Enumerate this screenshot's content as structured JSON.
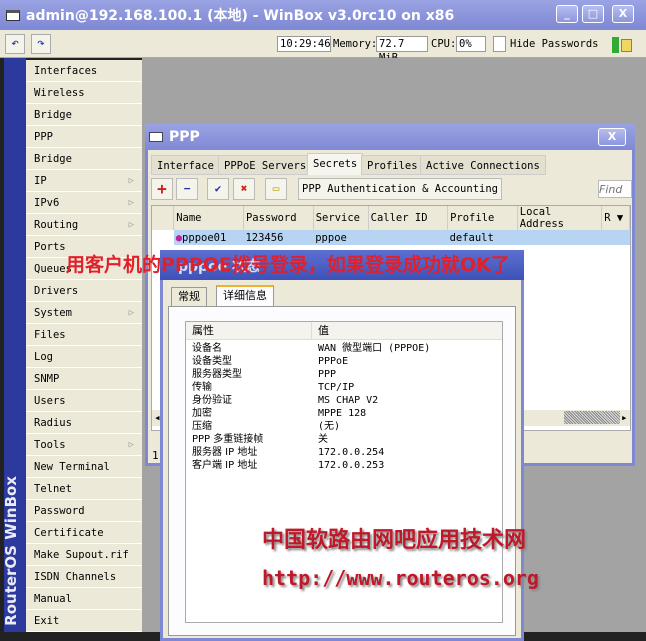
{
  "window": {
    "title": "admin@192.168.100.1 (本地) - WinBox v3.0rc10 on x86",
    "minimize": "_",
    "maximize": "□",
    "close": "X"
  },
  "toolbar": {
    "undo": "↶",
    "redo": "↷",
    "time": "10:29:46",
    "memory_label": "Memory:",
    "memory": "72.7 MiB",
    "cpu_label": "CPU:",
    "cpu": "0%",
    "hide_passwords": "Hide Passwords",
    "hide_passwords_checked": false
  },
  "sidebar": {
    "brand": "RouterOS WinBox",
    "items": [
      {
        "label": "Interfaces"
      },
      {
        "label": "Wireless"
      },
      {
        "label": "Bridge"
      },
      {
        "label": "PPP"
      },
      {
        "label": "Bridge"
      },
      {
        "label": "IP",
        "submenu": true
      },
      {
        "label": "IPv6",
        "submenu": true
      },
      {
        "label": "Routing",
        "submenu": true
      },
      {
        "label": "Ports"
      },
      {
        "label": "Queues"
      },
      {
        "label": "Drivers"
      },
      {
        "label": "System",
        "submenu": true
      },
      {
        "label": "Files"
      },
      {
        "label": "Log"
      },
      {
        "label": "SNMP"
      },
      {
        "label": "Users"
      },
      {
        "label": "Radius"
      },
      {
        "label": "Tools",
        "submenu": true
      },
      {
        "label": "New Terminal"
      },
      {
        "label": "Telnet"
      },
      {
        "label": "Password"
      },
      {
        "label": "Certificate"
      },
      {
        "label": "Make Supout.rif"
      },
      {
        "label": "ISDN Channels"
      },
      {
        "label": "Manual"
      },
      {
        "label": "Exit"
      }
    ]
  },
  "ppp": {
    "title": "PPP",
    "close": "X",
    "tabs": [
      "Interface",
      "PPPoE Servers",
      "Secrets",
      "Profiles",
      "Active Connections"
    ],
    "active_tab": "Secrets",
    "auth_button": "PPP Authentication & Accounting",
    "find_placeholder": "Find",
    "columns": [
      "Name",
      "Password",
      "Service",
      "Caller ID",
      "Profile",
      "Local Address",
      "R"
    ],
    "rows": [
      [
        "pppoe01",
        "123456",
        "pppoe",
        "",
        "default",
        ""
      ]
    ],
    "status": "1"
  },
  "dialog": {
    "title": "pppoe 状态",
    "tabs": [
      "常规",
      "详细信息"
    ],
    "active_tab": "详细信息",
    "headers": [
      "属性",
      "值"
    ],
    "rows": [
      [
        "设备名",
        "WAN 微型端口 (PPPOE)"
      ],
      [
        "设备类型",
        "PPPoE"
      ],
      [
        "服务器类型",
        "PPP"
      ],
      [
        "传输",
        "TCP/IP"
      ],
      [
        "身份验证",
        "MS CHAP V2"
      ],
      [
        "加密",
        "MPPE 128"
      ],
      [
        "压缩",
        "(无)"
      ],
      [
        "PPP 多重链接帧",
        "关"
      ],
      [
        "服务器 IP 地址",
        "172.0.0.254"
      ],
      [
        "客户端 IP 地址",
        "172.0.0.253"
      ]
    ]
  },
  "annotation": "用客户机的PPPOE拨号登录，如果登录成功就OK了",
  "watermark": {
    "line1": "中国软路由网吧应用技术网",
    "line2": "http://www.routeros.org"
  },
  "colors": {
    "titlebar": "#7e88d3",
    "selected_row": "#b7d5f2",
    "annotation": "#e0202a"
  }
}
